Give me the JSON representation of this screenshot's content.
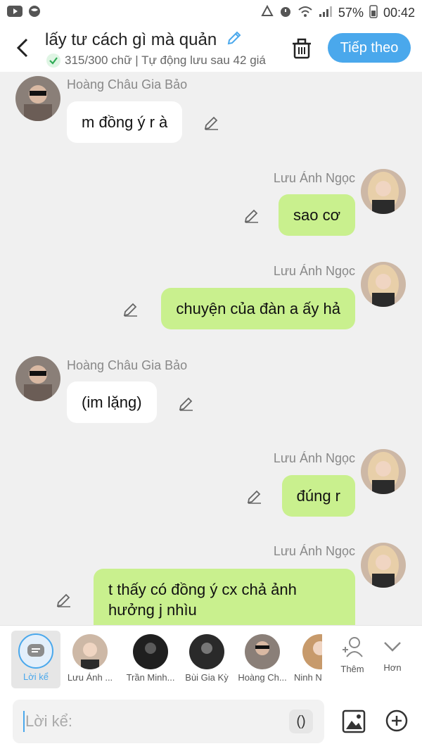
{
  "status": {
    "battery": "57%",
    "time": "00:42"
  },
  "header": {
    "title": "lấy tư cách gì mà quản",
    "subtitle": "315/300 chữ | Tự động lưu sau 42 giá",
    "next_label": "Tiếp theo"
  },
  "messages": [
    {
      "side": "left",
      "name": "Hoàng Châu Gia Bảo",
      "text": "m đồng ý r à"
    },
    {
      "side": "right",
      "name": "Lưu Ánh Ngọc",
      "text": "sao cơ"
    },
    {
      "side": "right",
      "name": "Lưu Ánh Ngọc",
      "text": "chuyện của đàn a ấy hả"
    },
    {
      "side": "left",
      "name": "Hoàng Châu Gia Bảo",
      "text": "(im lặng)"
    },
    {
      "side": "right",
      "name": "Lưu Ánh Ngọc",
      "text": "đúng r"
    },
    {
      "side": "right",
      "name": "Lưu Ánh Ngọc",
      "text": "t thấy có đồng ý cx chả ảnh hưởng j nhìu"
    }
  ],
  "characters": {
    "narration": "Lời kể",
    "items": [
      "Lưu Ánh ...",
      "Trần Minh...",
      "Bùi Gia Kỳ",
      "Hoàng Ch...",
      "Ninh N"
    ],
    "add_label": "Thêm",
    "more_label": "Hơn"
  },
  "composer": {
    "placeholder": "Lời kể:",
    "paren": "()"
  },
  "colors": {
    "accent": "#4aa8ec",
    "bubble_right": "#c9f08e",
    "bubble_left": "#ffffff",
    "background": "#f0f0f0"
  }
}
